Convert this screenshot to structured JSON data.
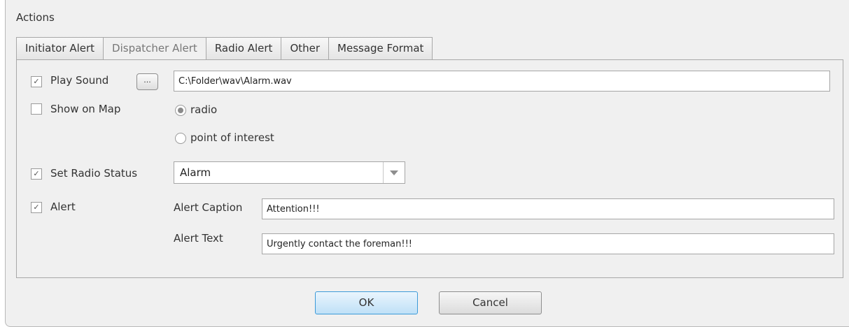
{
  "section": {
    "title": "Actions"
  },
  "tabs": [
    {
      "label": "Initiator Alert",
      "active": false
    },
    {
      "label": "Dispatcher Alert",
      "active": true
    },
    {
      "label": "Radio Alert",
      "active": false
    },
    {
      "label": "Other",
      "active": false
    },
    {
      "label": "Message Format",
      "active": false
    }
  ],
  "play_sound": {
    "checked": true,
    "label": "Play Sound",
    "browse_label": "...",
    "path": "C:\\Folder\\wav\\Alarm.wav"
  },
  "show_on_map": {
    "checked": false,
    "label": "Show on Map",
    "options": [
      {
        "label": "radio",
        "selected": true
      },
      {
        "label": "point of interest",
        "selected": false
      }
    ]
  },
  "set_radio_status": {
    "checked": true,
    "label": "Set Radio Status",
    "value": "Alarm"
  },
  "alert": {
    "checked": true,
    "label": "Alert",
    "caption_label": "Alert Caption",
    "caption_value": "Attention!!!",
    "text_label": "Alert Text",
    "text_value": "Urgently contact the foreman!!!"
  },
  "buttons": {
    "ok": "OK",
    "cancel": "Cancel"
  },
  "glyphs": {
    "check": "✓"
  },
  "colors": {
    "ok_border": "#3c9ad8",
    "panel_bg": "#f0f0f0"
  }
}
